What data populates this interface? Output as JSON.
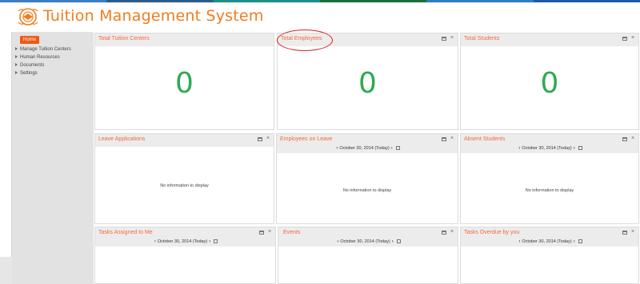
{
  "app": {
    "title": "Tuition Management System"
  },
  "colors": {
    "topbar": [
      "#3a7fc4",
      "#2b5d8a",
      "#1e8f8a",
      "#1b6e3c",
      "#2a7fc2",
      "#1e5aa8"
    ],
    "accent": "#f07d1e",
    "count_green": "#2eaa52",
    "annotation": "#d62020"
  },
  "sidebar": {
    "home_label": "Home",
    "items": [
      {
        "label": "Manage Tuition Centers"
      },
      {
        "label": "Human Resources"
      },
      {
        "label": "Documents"
      },
      {
        "label": "Settings"
      }
    ]
  },
  "panels": {
    "tuition_centers": {
      "title": "Total Tuition Centers",
      "count": "0"
    },
    "employees": {
      "title": "Total Employees",
      "count": "0"
    },
    "students": {
      "title": "Total Students",
      "count": "0"
    },
    "leave_applications": {
      "title": "Leave Applications",
      "empty": "No information to display"
    },
    "employees_on_leave": {
      "title": "Employees on Leave",
      "date": "October 30, 2014 (Today)",
      "empty": "No information to display"
    },
    "absent_students": {
      "title": "Absent Students",
      "date": "October 30, 2014 (Today)",
      "empty": "No information to display"
    },
    "tasks_assigned": {
      "title": "Tasks Assigned to Me",
      "date": "October 30, 2014 (Today)"
    },
    "events": {
      "title": "Events",
      "date": "October 30, 2014 (Today)"
    },
    "tasks_overdue": {
      "title": "Tasks Overdue by you",
      "date": "October 30, 2014 (Today)"
    }
  },
  "icons": {
    "prev": "‹",
    "next": "›",
    "close": "×"
  }
}
